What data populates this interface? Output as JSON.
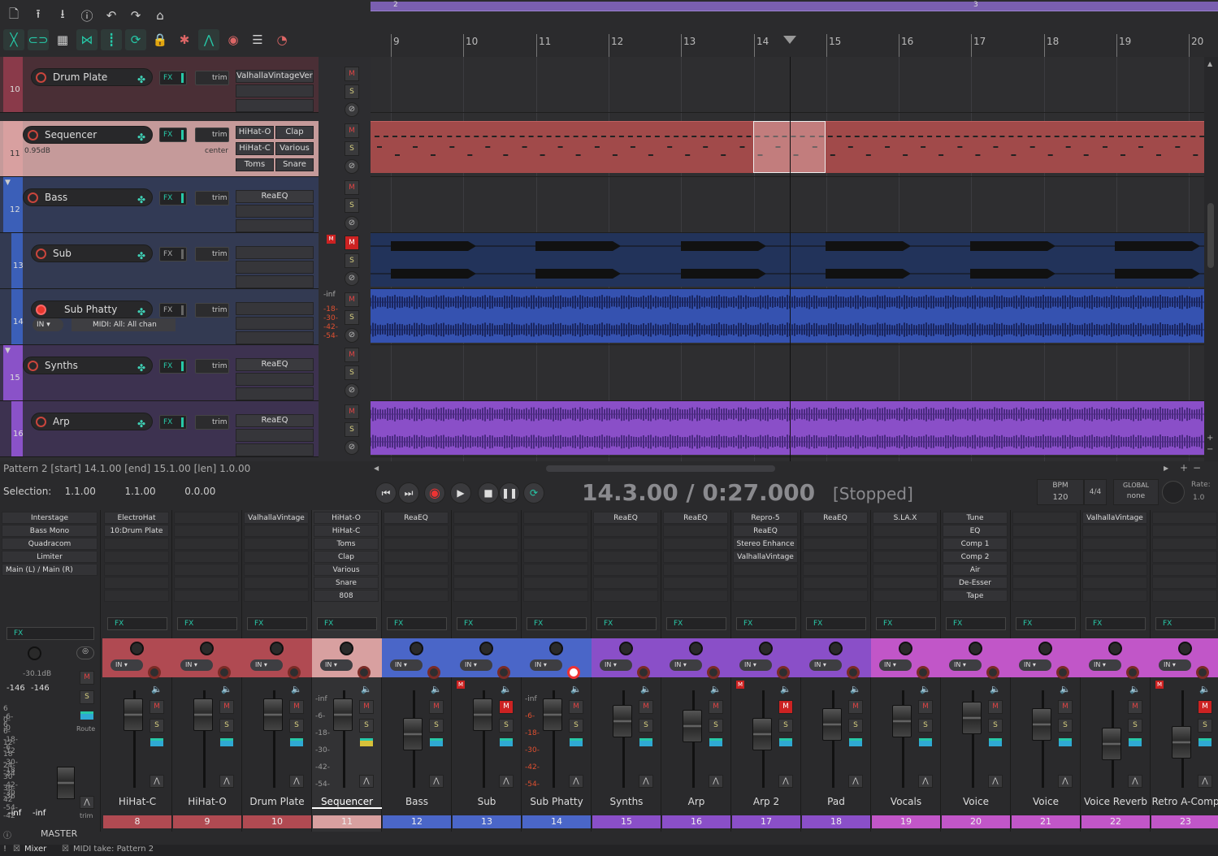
{
  "ruler": {
    "regions": [
      "2",
      "3"
    ],
    "ticks": [
      "9",
      "10",
      "11",
      "12",
      "13",
      "14",
      "15",
      "16",
      "17",
      "18",
      "19",
      "20"
    ]
  },
  "tracks": [
    {
      "num": "10",
      "name": "Drum Plate",
      "fx": [
        "ValhallaVintageVerb"
      ],
      "color": "#8a3a4a"
    },
    {
      "num": "11",
      "name": "Sequencer",
      "vol": "0.95dB",
      "pan": "center",
      "fx_grid": [
        "HiHat-O",
        "Clap",
        "HiHat-C",
        "Various",
        "Toms",
        "Snare"
      ],
      "color": "#d8a0a0"
    },
    {
      "num": "12",
      "name": "Bass",
      "fx": [
        "ReaEQ"
      ],
      "color": "#3b5fb8"
    },
    {
      "num": "13",
      "name": "Sub",
      "fx": [],
      "color": "#3b5fb8"
    },
    {
      "num": "14",
      "name": "Sub Phatty",
      "in": "IN",
      "midi": "MIDI: All: All chan",
      "fx": [],
      "color": "#3b5fb8"
    },
    {
      "num": "15",
      "name": "Synths",
      "fx": [
        "ReaEQ"
      ],
      "color": "#8a52c8"
    },
    {
      "num": "16",
      "name": "Arp",
      "fx": [
        "ReaEQ"
      ],
      "color": "#8a52c8"
    }
  ],
  "tcp": {
    "fx_label": "FX",
    "trim_label": "trim",
    "meter_values": [
      "-inf",
      "-18-",
      "-30-",
      "-42-",
      "-54-"
    ]
  },
  "status": {
    "pattern_line": "Pattern 2 [start] 14.1.00 [end] 15.1.00 [len] 1.0.00",
    "selection_label": "Selection:",
    "sel_start": "1.1.00",
    "sel_end": "1.1.00",
    "sel_len": "0.0.00"
  },
  "transport": {
    "timecode": "14.3.00 / 0:27.000",
    "state": "[Stopped]",
    "bpm_label": "BPM",
    "bpm": "120",
    "timesig": "4/4",
    "global_label": "GLOBAL",
    "global_value": "none",
    "rate_label": "Rate:",
    "rate_value": "1.0"
  },
  "master": {
    "fx": [
      "Interstage",
      "Bass Mono",
      "Quadracom",
      "Limiter",
      "Main (L) / Main (R)"
    ],
    "fx_label": "FX",
    "db": "-30.1dB",
    "peak_l": "-146",
    "peak_r": "-146",
    "inf_l": "-inf",
    "inf_r": "-inf",
    "route": "Route",
    "trim": "trim",
    "label": "MASTER"
  },
  "strips": [
    {
      "name": "HiHat-C",
      "num": "8",
      "color": "#b04a52",
      "fx": [
        "ElectroHat",
        "10:Drum Plate"
      ]
    },
    {
      "name": "HiHat-O",
      "num": "9",
      "color": "#b04a52",
      "fx": []
    },
    {
      "name": "Drum Plate",
      "num": "10",
      "color": "#b04a52",
      "fx": [
        "ValhallaVintage"
      ]
    },
    {
      "name": "Sequencer",
      "num": "11",
      "color": "#d8a0a0",
      "fx": [
        "HiHat-O",
        "HiHat-C",
        "Toms",
        "Clap",
        "Various",
        "Snare",
        "808"
      ],
      "selected": true,
      "meter": [
        "-inf",
        "-6-",
        "-18-",
        "-30-",
        "-42-",
        "-54-"
      ]
    },
    {
      "name": "Bass",
      "num": "12",
      "color": "#4a66c8",
      "fx": [
        "ReaEQ"
      ]
    },
    {
      "name": "Sub",
      "num": "13",
      "color": "#4a66c8",
      "fx": [],
      "muted": true
    },
    {
      "name": "Sub Phatty",
      "num": "14",
      "color": "#4a66c8",
      "fx": [],
      "armed": true,
      "meter": [
        "-inf",
        "-6-",
        "-18-",
        "-30-",
        "-42-",
        "-54-"
      ]
    },
    {
      "name": "Synths",
      "num": "15",
      "color": "#8a4fc8",
      "fx": [
        "ReaEQ"
      ]
    },
    {
      "name": "Arp",
      "num": "16",
      "color": "#8a4fc8",
      "fx": [
        "ReaEQ"
      ]
    },
    {
      "name": "Arp 2",
      "num": "17",
      "color": "#8a4fc8",
      "fx": [
        "Repro-5",
        "ReaEQ",
        "Stereo Enhance",
        "ValhallaVintage"
      ],
      "muted": true
    },
    {
      "name": "Pad",
      "num": "18",
      "color": "#8a4fc8",
      "fx": [
        "ReaEQ"
      ]
    },
    {
      "name": "Vocals",
      "num": "19",
      "color": "#c156c8",
      "fx": [
        "S.LA.X"
      ]
    },
    {
      "name": "Voice",
      "num": "20",
      "color": "#c156c8",
      "fx": [
        "Tune",
        "EQ",
        "Comp 1",
        "Comp 2",
        "Air",
        "De-Esser",
        "Tape"
      ]
    },
    {
      "name": "Voice",
      "num": "21",
      "color": "#c156c8",
      "fx": []
    },
    {
      "name": "Voice Reverb",
      "num": "22",
      "color": "#c156c8",
      "fx": [
        "ValhallaVintage"
      ]
    },
    {
      "name": "Retro A-Comp",
      "num": "23",
      "color": "#c156c8",
      "fx": [],
      "muted": true
    }
  ],
  "bottom": {
    "mixer_tab": "Mixer",
    "midi_tab": "MIDI take: Pattern 2"
  },
  "strip_labels": {
    "fx": "FX",
    "in": "IN",
    "m": "M",
    "s": "S"
  }
}
